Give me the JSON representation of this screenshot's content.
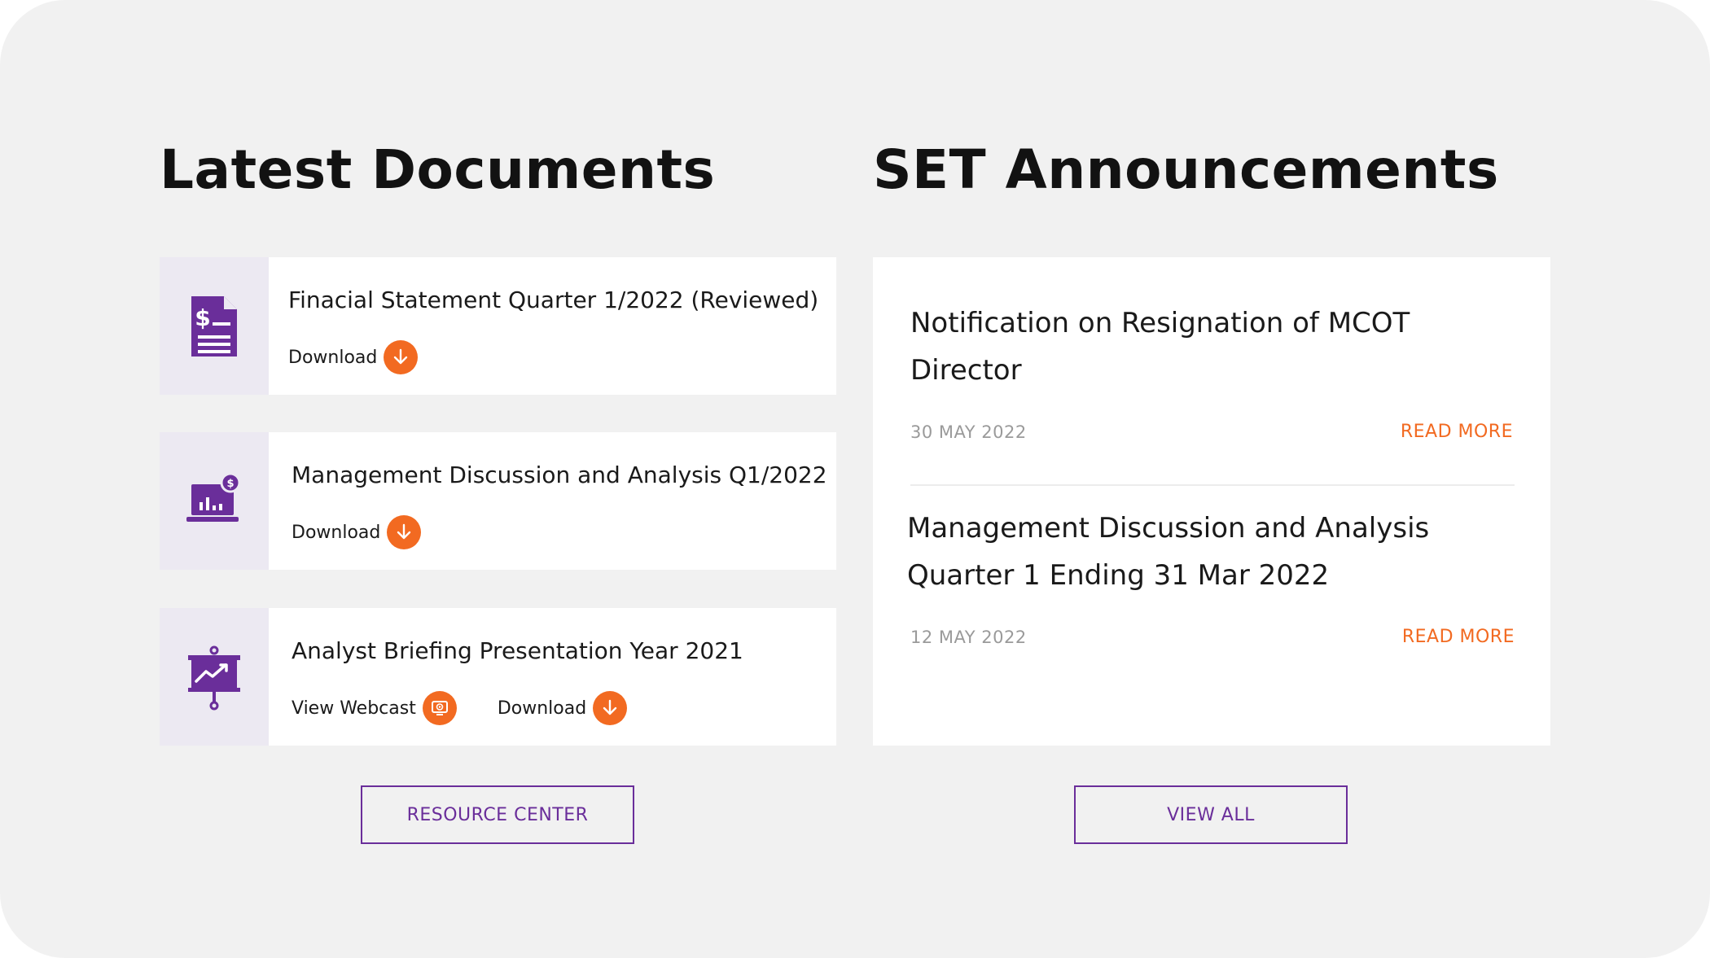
{
  "colors": {
    "accent": "#f26a21",
    "brand": "#6a2e9a",
    "icon_bg": "#ece9f2"
  },
  "latest_documents": {
    "title": "Latest Documents",
    "items": [
      {
        "title": "Finacial Statement Quarter 1/2022 (Reviewed)",
        "icon": "financial-document-icon",
        "actions": [
          {
            "label": "Download",
            "icon": "download-icon"
          }
        ]
      },
      {
        "title": "Management Discussion and Analysis Q1/2022",
        "icon": "laptop-chart-icon",
        "actions": [
          {
            "label": "Download",
            "icon": "download-icon"
          }
        ]
      },
      {
        "title": "Analyst Briefing Presentation Year 2021",
        "icon": "presentation-board-icon",
        "actions": [
          {
            "label": "View Webcast",
            "icon": "webcast-icon"
          },
          {
            "label": "Download",
            "icon": "download-icon"
          }
        ]
      }
    ],
    "button_label": "RESOURCE CENTER"
  },
  "set_announcements": {
    "title": "SET Announcements",
    "items": [
      {
        "title": "Notification on Resignation of MCOT Director",
        "date": "30 MAY 2022",
        "link_label": "READ MORE"
      },
      {
        "title": "Management Discussion and Analysis Quarter 1 Ending 31 Mar 2022",
        "date": "12 MAY 2022",
        "link_label": "READ MORE"
      }
    ],
    "button_label": "VIEW ALL"
  }
}
